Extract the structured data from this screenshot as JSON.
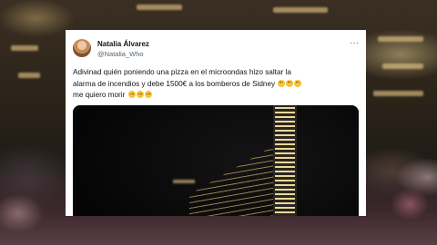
{
  "tweet": {
    "author_name": "Natalia Álvarez",
    "author_handle": "@Natalia_Who",
    "more_label": "···",
    "text_line1": "Adivinad quién poniendo una pizza en el microondas hizo saltar la",
    "text_line2": "alarma de incendios y debe 1500€ a los bomberos de Sidney",
    "text_line3": "me quiero morir",
    "emoji": "slightly-frowning-face"
  },
  "colors": {
    "text": "#0f1419",
    "secondary": "#536471",
    "card_bg": "#ffffff",
    "video_bg": "#070707"
  }
}
